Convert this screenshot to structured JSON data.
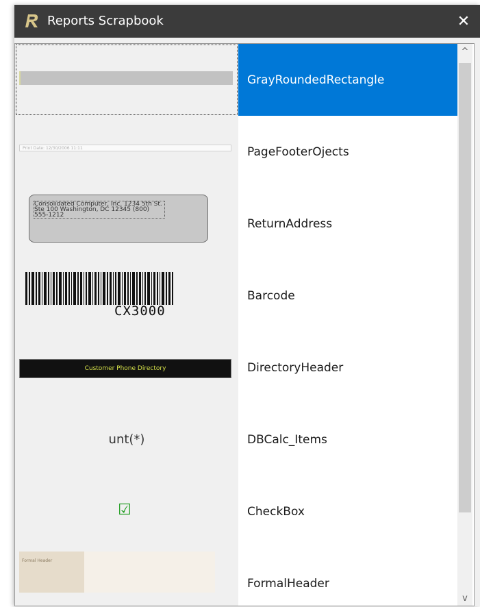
{
  "window": {
    "title": "Reports Scrapbook",
    "close_glyph": "✕",
    "app_icon": "report-builder-icon"
  },
  "scrollbar": {
    "up_glyph": "^",
    "down_glyph": "v"
  },
  "items": [
    {
      "label": "GrayRoundedRectangle",
      "selected": true
    },
    {
      "label": "PageFooterOjects",
      "selected": false
    },
    {
      "label": "ReturnAddress",
      "selected": false
    },
    {
      "label": "Barcode",
      "selected": false
    },
    {
      "label": "DirectoryHeader",
      "selected": false
    },
    {
      "label": "DBCalc_Items",
      "selected": false
    },
    {
      "label": "CheckBox",
      "selected": false
    },
    {
      "label": "FormalHeader",
      "selected": false
    }
  ],
  "previews": {
    "footer_text": "Print Date: 12/30/2006 11:11",
    "return_address": "Consolidated Computer, Inc. 1234 5th St. Ste 100 Washington, DC 12345 (800) 555-1212",
    "barcode_text": "CX3000",
    "directory_header_text": "Customer Phone Directory",
    "dbcalc_text": "unt(*)",
    "checkbox_glyph": "☑",
    "formal_header_text": "Formal Header"
  },
  "colors": {
    "selection": "#0078d7",
    "titlebar": "#3b3b3b"
  }
}
